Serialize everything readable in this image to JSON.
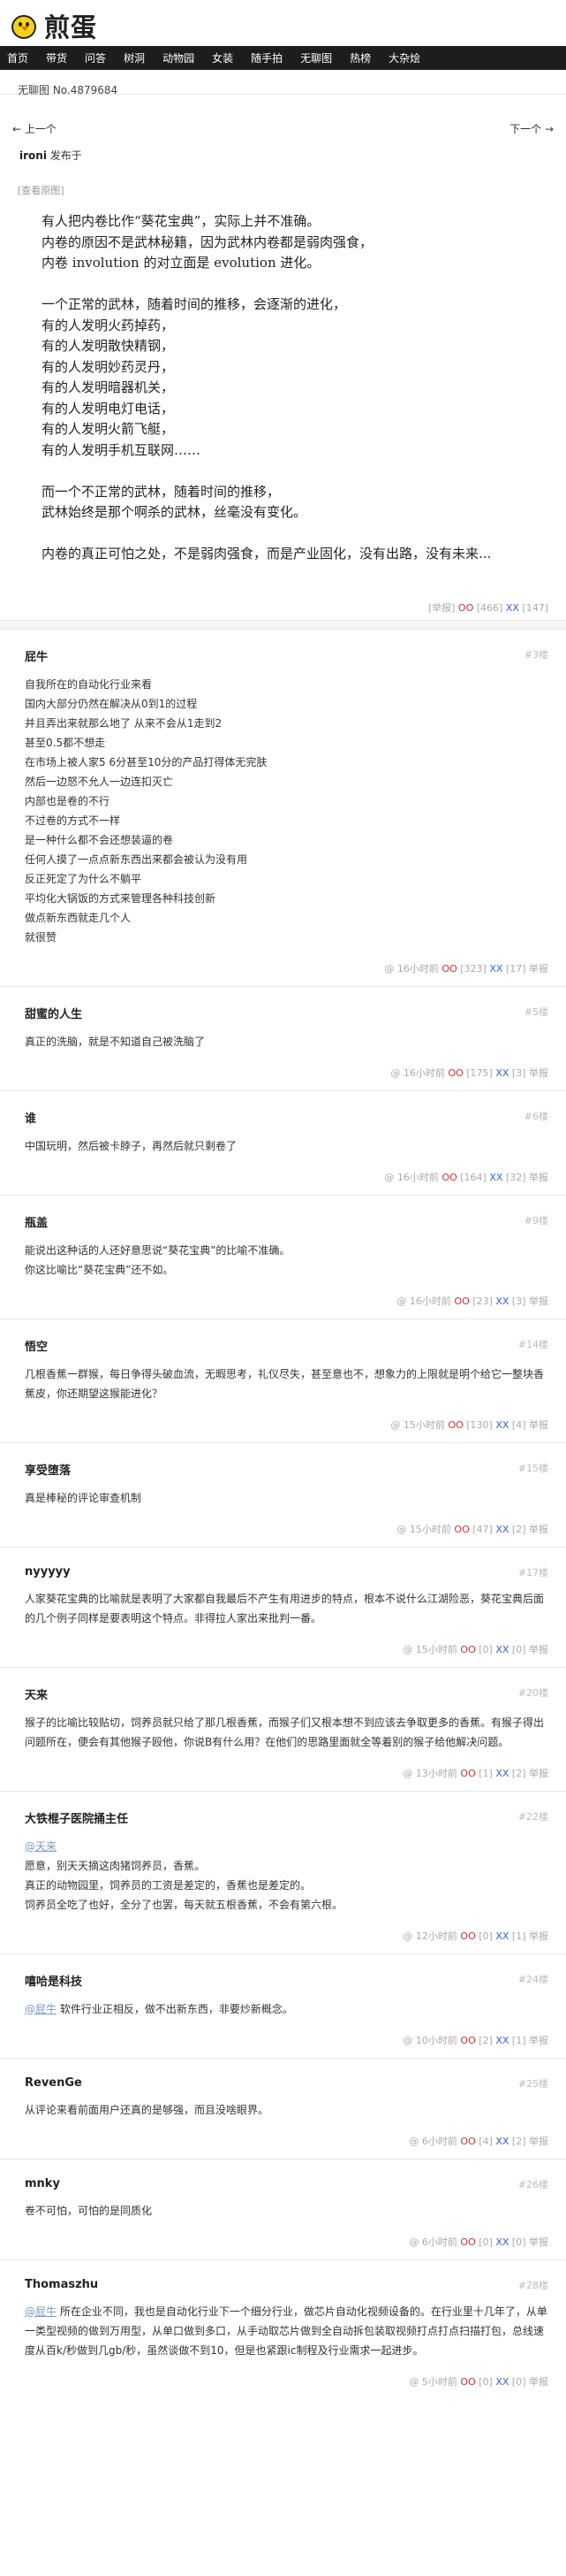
{
  "site": {
    "logo_text": "煎蛋"
  },
  "nav": [
    "首页",
    "带货",
    "问答",
    "树洞",
    "动物园",
    "女装",
    "随手拍",
    "无聊图",
    "热榜",
    "大杂烩"
  ],
  "page_number_label": "无聊图 No.4879684",
  "pager": {
    "prev": "← 上一个",
    "next": "下一个 →"
  },
  "post": {
    "author": "ironi",
    "action": "发布于",
    "view_pic": "[查看原图]",
    "lines": [
      "有人把内卷比作“葵花宝典”，实际上并不准确。",
      "内卷的原因不是武林秘籍，因为武林内卷都是弱肉强食，",
      "内卷 involution 的对立面是 evolution 进化。",
      "",
      "一个正常的武林，随着时间的推移，会逐渐的进化，",
      "有的人发明火药掉药，",
      "有的人发明散快精钢，",
      "有的人发明妙药灵丹，",
      "有的人发明暗器机关，",
      "有的人发明电灯电话，",
      "有的人发明火箭飞艇，",
      "有的人发明手机互联网……",
      "",
      "而一个不正常的武林，随着时间的推移，",
      "武林始终是那个啊杀的武林，丝毫没有变化。",
      "",
      "内卷的真正可怕之处，不是弱肉强食，而是产业固化，没有出路，没有未来..."
    ],
    "report": "[举报]",
    "oo_label": "OO",
    "oo": "[466]",
    "xx_label": "XX",
    "xx": "[147]"
  },
  "comments": [
    {
      "author": "屁牛",
      "floor": "#3楼",
      "lines": [
        "自我所在的自动化行业来看",
        "国内大部分仍然在解决从0到1的过程",
        "并且弄出来就那么地了 从来不会从1走到2",
        "甚至0.5都不想走",
        "在市场上被人家5 6分甚至10分的产品打得体无完肤",
        "然后一边怒不允人一边连扣灭亡",
        "内部也是卷的不行",
        "不过卷的方式不一样",
        "是一种什么都不会还想装逼的卷",
        "任何人摸了一点点新东西出来都会被认为没有用",
        "反正死定了为什么不躺平",
        "平均化大锅饭的方式来管理各种科技创新",
        "做点新东西就走几个人",
        "就很赞"
      ],
      "time": "@ 16小时前",
      "oo": "[323]",
      "xx": "[17]",
      "report": "举报"
    },
    {
      "author": "甜蜜的人生",
      "floor": "#5楼",
      "lines": [
        "真正的洗脑，就是不知道自己被洗脑了"
      ],
      "time": "@ 16小时前",
      "oo": "[175]",
      "xx": "[3]",
      "report": "举报"
    },
    {
      "author": "谁",
      "floor": "#6楼",
      "lines": [
        "中国玩明，然后被卡脖子，再然后就只剩卷了"
      ],
      "time": "@ 16小时前",
      "oo": "[164]",
      "xx": "[32]",
      "report": "举报"
    },
    {
      "author": "瓶盖",
      "floor": "#9楼",
      "lines": [
        "能说出这种话的人还好意思说“葵花宝典”的比喻不准确。",
        "你这比喻比“葵花宝典”还不如。"
      ],
      "time": "@ 16小时前",
      "oo": "[23]",
      "xx": "[3]",
      "report": "举报"
    },
    {
      "author": "悟空",
      "floor": "#14楼",
      "lines": [
        "几根香蕉一群猴，每日争得头破血流，无暇思考，礼仪尽失，甚至意也不，想象力的上限就是明个给它一整块香蕉皮，你还期望这猴能进化？"
      ],
      "time": "@ 15小时前",
      "oo": "[130]",
      "xx": "[4]",
      "report": "举报"
    },
    {
      "author": "享受堕落",
      "floor": "#15楼",
      "lines": [
        "真是棒秘的评论审查机制"
      ],
      "time": "@ 15小时前",
      "oo": "[47]",
      "xx": "[2]",
      "report": "举报"
    },
    {
      "author": "nyyyyy",
      "floor": "#17楼",
      "lines": [
        "人家葵花宝典的比喻就是表明了大家都自我最后不产生有用进步的特点，根本不说什么江湖险恶，葵花宝典后面的几个例子同样是要表明这个特点。非得拉人家出来批判一番。"
      ],
      "time": "@ 15小时前",
      "oo": "[0]",
      "xx": "[0]",
      "report": "举报"
    },
    {
      "author": "天来",
      "floor": "#20楼",
      "lines": [
        "猴子的比喻比较贴切，饲养员就只给了那几根香蕉，而猴子们又根本想不到应该去争取更多的香蕉。有猴子得出问题所在，便会有其他猴子殴他，你说B有什么用？在他们的思路里面就全等着别的猴子给他解决问题。"
      ],
      "time": "@ 13小时前",
      "oo": "[1]",
      "xx": "[2]",
      "report": "举报"
    },
    {
      "author": "大铁棍子医院捅主任",
      "floor": "#22楼",
      "quote": "@天来",
      "lines": [
        "愿意，别天天摘这肉猪饲养员，香蕉。",
        "真正的动物园里，饲养员的工资是差定的，香蕉也是差定的。",
        "饲养员全吃了也好，全分了也罢，每天就五根香蕉，不会有第六根。"
      ],
      "time": "@ 12小时前",
      "oo": "[0]",
      "xx": "[1]",
      "report": "举报"
    },
    {
      "author": "嘻哈是科技",
      "floor": "#24楼",
      "quote": "@屁牛",
      "lines": [
        "软件行业正相反，做不出新东西，非要炒新概念。"
      ],
      "time": "@ 10小时前",
      "oo": "[2]",
      "xx": "[1]",
      "report": "举报"
    },
    {
      "author": "RevenGe",
      "floor": "#25楼",
      "lines": [
        "从评论来看前面用户还真的是够强，而且没啥眼界。"
      ],
      "time": "@ 6小时前",
      "oo": "[4]",
      "xx": "[2]",
      "report": "举报"
    },
    {
      "author": "mnky",
      "floor": "#26楼",
      "lines": [
        "卷不可怕，可怕的是同质化"
      ],
      "time": "@ 6小时前",
      "oo": "[0]",
      "xx": "[0]",
      "report": "举报"
    },
    {
      "author": "Thomaszhu",
      "floor": "#28楼",
      "quote": "@屁牛",
      "lines": [
        "所在企业不同，我也是自动化行业下一个细分行业，做芯片自动化视频设备的。在行业里十几年了，从单一类型视频的做到万用型，从单口做到多口，从手动取芯片做到全自动拆包装取视频打点打点扫描打包，总线速度从百k/秒做到几gb/秒，虽然谈做不到10，但是也紧跟ic制程及行业需求一起进步。"
      ],
      "time": "@ 5小时前",
      "oo": "[0]",
      "xx": "[0]",
      "report": "举报"
    }
  ]
}
